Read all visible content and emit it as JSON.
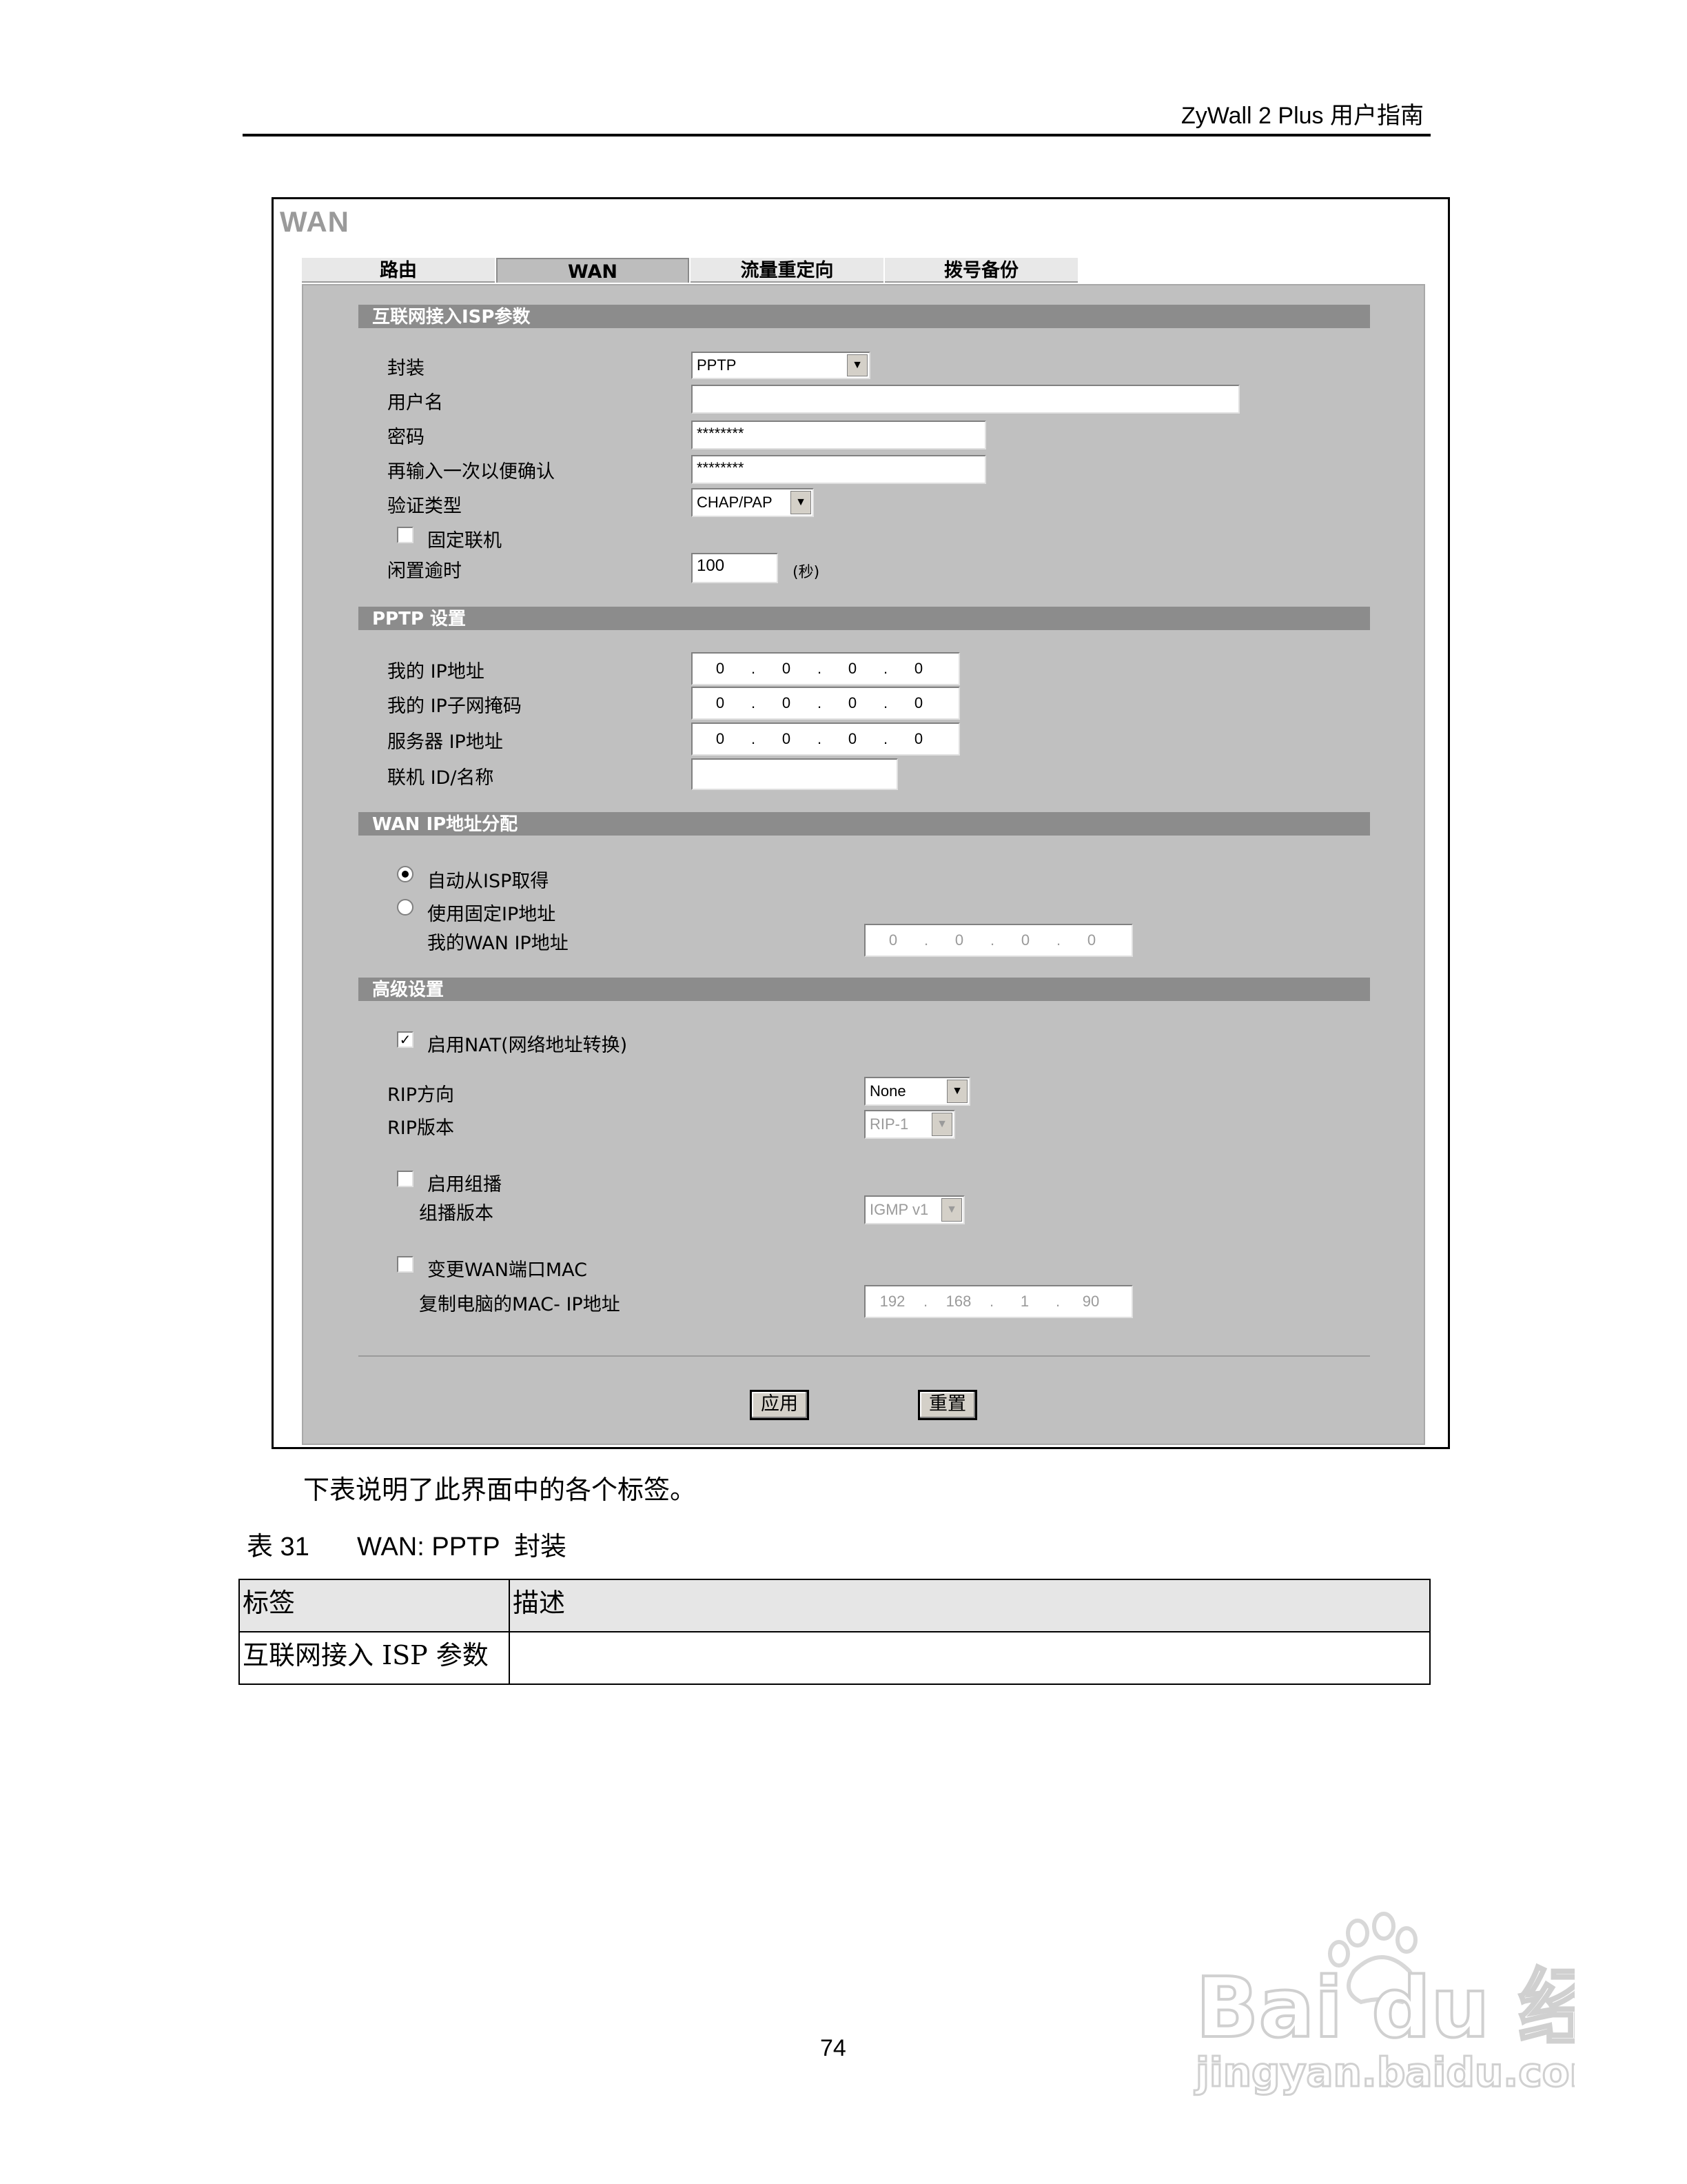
{
  "header": {
    "title": "ZyWall 2 Plus 用户指南"
  },
  "screen": {
    "title": "WAN",
    "tabs": [
      "路由",
      "WAN",
      "流量重定向",
      "拨号备份"
    ],
    "active_tab": "WAN",
    "isp": {
      "section_title": "互联网接入ISP参数",
      "encapsulation_label": "封装",
      "encapsulation_value": "PPTP",
      "username_label": "用户名",
      "username_value": "",
      "password_label": "密码",
      "password_value": "********",
      "retype_label": "再输入一次以便确认",
      "retype_value": "********",
      "auth_label": "验证类型",
      "auth_value": "CHAP/PAP",
      "nailed_label": "固定联机",
      "nailed_checked": false,
      "idle_label": "闲置逾时",
      "idle_value": "100",
      "idle_unit": "(秒)"
    },
    "pptp": {
      "section_title": "PPTP 设置",
      "my_ip_label": "我的 IP地址",
      "my_ip": [
        "0",
        "0",
        "0",
        "0"
      ],
      "my_mask_label": "我的 IP子网掩码",
      "my_mask": [
        "0",
        "0",
        "0",
        "0"
      ],
      "server_ip_label": "服务器 IP地址",
      "server_ip": [
        "0",
        "0",
        "0",
        "0"
      ],
      "conn_id_label": "联机 ID/名称",
      "conn_id_value": ""
    },
    "wan_ip": {
      "section_title": "WAN IP地址分配",
      "auto_label": "自动从ISP取得",
      "auto_selected": true,
      "fixed_label": "使用固定IP地址",
      "my_wan_ip_label": "我的WAN IP地址",
      "my_wan_ip": [
        "0",
        "0",
        "0",
        "0"
      ]
    },
    "advanced": {
      "section_title": "高级设置",
      "nat_label": "启用NAT(网络地址转换)",
      "nat_checked": true,
      "rip_dir_label": "RIP方向",
      "rip_dir_value": "None",
      "rip_ver_label": "RIP版本",
      "rip_ver_value": "RIP-1",
      "multicast_label": "启用组播",
      "multicast_checked": false,
      "multicast_ver_label": "组播版本",
      "multicast_ver_value": "IGMP v1",
      "mac_label": "变更WAN端口MAC",
      "mac_checked": false,
      "clone_label": "复制电脑的MAC- IP地址",
      "clone_ip": [
        "192",
        "168",
        "1",
        "90"
      ]
    },
    "buttons": {
      "apply": "应用",
      "reset": "重置"
    }
  },
  "doc": {
    "intro": "下表说明了此界面中的各个标签。",
    "table_caption_num": "表 31",
    "table_caption_title": "WAN: PPTP  封装",
    "table_headers": [
      "标签",
      "描述"
    ],
    "table_rows": [
      [
        "互联网接入 ISP 参数",
        ""
      ]
    ]
  },
  "page_number": "74",
  "watermark": {
    "brand": "Bai du 经验",
    "url": "jingyan.baidu.com"
  }
}
